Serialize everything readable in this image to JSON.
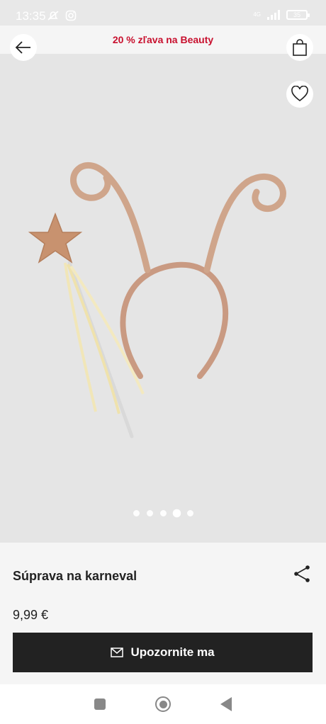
{
  "status": {
    "time": "13:35",
    "network": "4G",
    "battery": "35"
  },
  "promo": {
    "text": "20 % zľava na Beauty"
  },
  "gallery": {
    "dot_count": 5,
    "active_index": 3
  },
  "product": {
    "title": "Súprava na karneval",
    "price": "9,99 €"
  },
  "cta": {
    "label": "Upozornite ma"
  },
  "icons": {
    "back": "arrow-left-icon",
    "bag": "shopping-bag-icon",
    "favorite": "heart-icon",
    "share": "share-icon",
    "mail": "mail-icon"
  },
  "colors": {
    "promo": "#c8102e",
    "cta_bg": "#222222",
    "image_bg": "#e5e5e5"
  }
}
